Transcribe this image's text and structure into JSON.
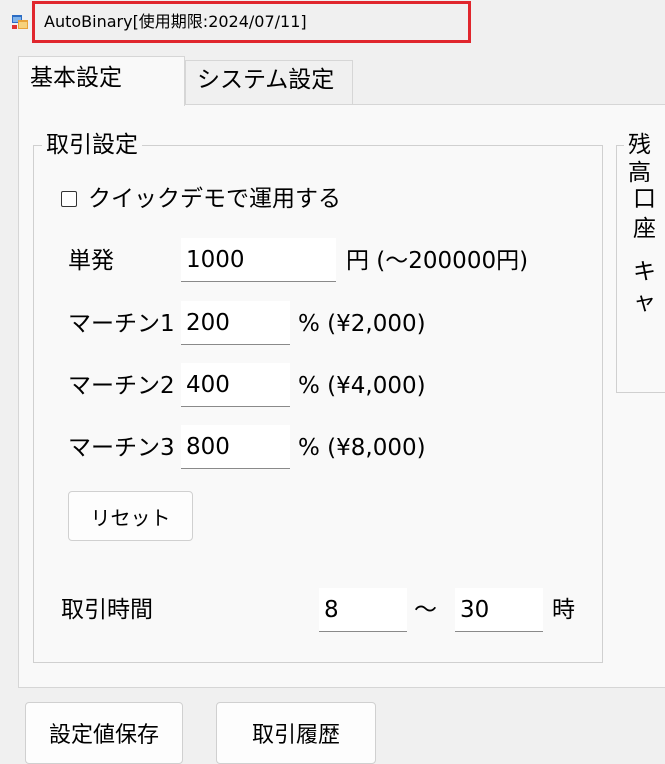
{
  "window": {
    "title": "AutoBinary[使用期限:2024/07/11]",
    "highlight_color": "#e0262d"
  },
  "tabs": [
    {
      "label": "基本設定",
      "selected": true
    },
    {
      "label": "システム設定",
      "selected": false
    }
  ],
  "trade_settings": {
    "title": "取引設定",
    "quick_demo": {
      "label": "クイックデモで運用する",
      "checked": false
    },
    "single": {
      "label": "単発",
      "value": "1000",
      "suffix": "円 (～200000円)"
    },
    "martin": [
      {
        "label": "マーチン1",
        "value": "200",
        "suffix": "% (¥2,000)"
      },
      {
        "label": "マーチン2",
        "value": "400",
        "suffix": "% (¥4,000)"
      },
      {
        "label": "マーチン3",
        "value": "800",
        "suffix": "% (¥8,000)"
      }
    ],
    "reset_label": "リセット",
    "trade_time": {
      "label": "取引時間",
      "start": "8",
      "separator": "～",
      "end": "30",
      "unit": "時"
    }
  },
  "balance": {
    "title": "残高",
    "row1_label": "口座",
    "row2_label": "キャ"
  },
  "footer": {
    "save_label": "設定値保存",
    "history_label": "取引履歴"
  }
}
